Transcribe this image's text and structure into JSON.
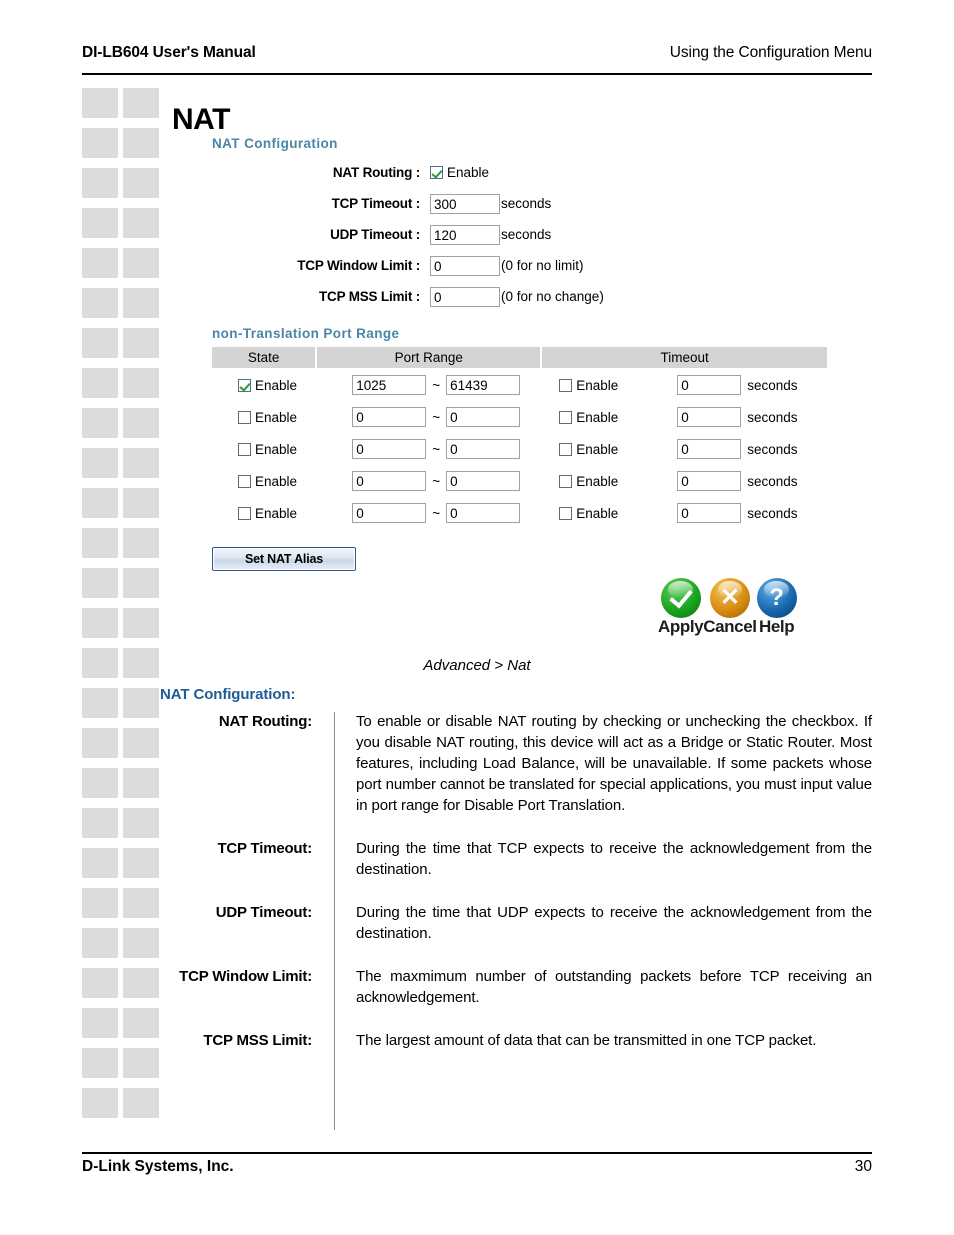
{
  "header": {
    "left": "DI-LB604 User's Manual",
    "right": "Using the Configuration Menu"
  },
  "page_title": "NAT",
  "ui": {
    "section1_heading": "NAT Configuration",
    "section2_heading": "non-Translation Port Range",
    "fields": [
      {
        "label": "NAT Routing :",
        "type": "checkbox",
        "checked": true,
        "checkbox_label": "Enable"
      },
      {
        "label": "TCP Timeout :",
        "type": "text",
        "value": "300",
        "unit": "seconds"
      },
      {
        "label": "UDP Timeout :",
        "type": "text",
        "value": "120",
        "unit": "seconds"
      },
      {
        "label": "TCP Window Limit :",
        "type": "text",
        "value": "0",
        "unit": "(0 for no limit)"
      },
      {
        "label": "TCP MSS Limit :",
        "type": "text",
        "value": "0",
        "unit": "(0 for no change)"
      }
    ],
    "table": {
      "columns": [
        "State",
        "Port Range",
        "Timeout"
      ],
      "enable_label": "Enable",
      "tilde": "~",
      "seconds_label": "seconds",
      "rows": [
        {
          "state_enabled": true,
          "port_start": "1025",
          "port_end": "61439",
          "timeout_enabled": false,
          "timeout": "0"
        },
        {
          "state_enabled": false,
          "port_start": "0",
          "port_end": "0",
          "timeout_enabled": false,
          "timeout": "0"
        },
        {
          "state_enabled": false,
          "port_start": "0",
          "port_end": "0",
          "timeout_enabled": false,
          "timeout": "0"
        },
        {
          "state_enabled": false,
          "port_start": "0",
          "port_end": "0",
          "timeout_enabled": false,
          "timeout": "0"
        },
        {
          "state_enabled": false,
          "port_start": "0",
          "port_end": "0",
          "timeout_enabled": false,
          "timeout": "0"
        }
      ]
    },
    "alias_button": "Set NAT Alias",
    "actions": [
      {
        "icon": "check-circle-icon",
        "label": "Apply",
        "color": "#18a21c"
      },
      {
        "icon": "x-circle-icon",
        "label": "Cancel",
        "color": "#d68a10"
      },
      {
        "icon": "question-circle-icon",
        "label": "Help",
        "color": "#1664ad"
      }
    ]
  },
  "caption": "Advanced > Nat",
  "definitions": {
    "title": "NAT Configuration:",
    "items": [
      {
        "term": "NAT Routing:",
        "desc": "To enable or disable NAT routing by checking or unchecking the checkbox. If you disable NAT routing, this device will act as a Bridge or Static Router. Most features, including Load Balance, will be unavailable. If some packets whose port number cannot be translated for special applications, you must input value in port range for Disable Port Translation."
      },
      {
        "term": "TCP Timeout:",
        "desc": "During the time that TCP expects to receive the acknowledgement from the destination."
      },
      {
        "term": "UDP Timeout:",
        "desc": "During the time that UDP expects to receive the acknowledgement from the destination."
      },
      {
        "term": "TCP Window Limit:",
        "desc": "The maxmimum number of outstanding packets before TCP receiving an acknowledgement."
      },
      {
        "term": "TCP MSS Limit:",
        "desc": "The largest amount of data that can be transmitted in one TCP packet."
      }
    ]
  },
  "footer": {
    "left": "D-Link Systems, Inc.",
    "right": "30"
  }
}
